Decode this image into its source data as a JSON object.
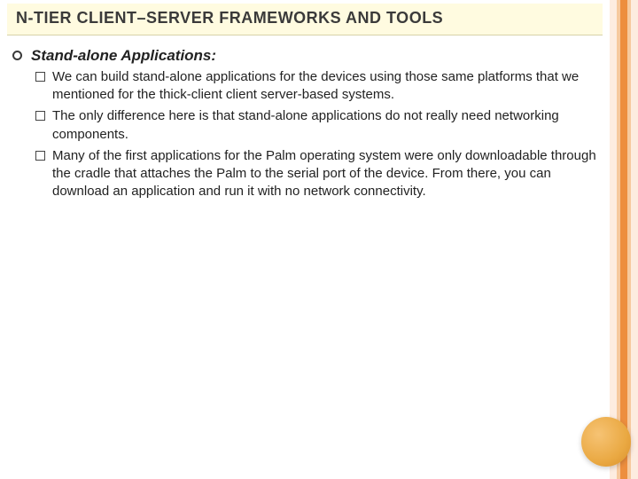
{
  "title": "N-TIER CLIENT–SERVER FRAMEWORKS AND TOOLS",
  "heading": "Stand-alone Applications:",
  "points": [
    "We can build stand-alone applications for the devices using those same platforms that we mentioned for the thick-client client server-based systems.",
    "The only difference here is that stand-alone applications do not really need networking components.",
    "Many of the first applications for the Palm operating system were only downloadable through the cradle that attaches the Palm to the serial port of the device. From there, you can download an application and run it with no network connectivity."
  ]
}
